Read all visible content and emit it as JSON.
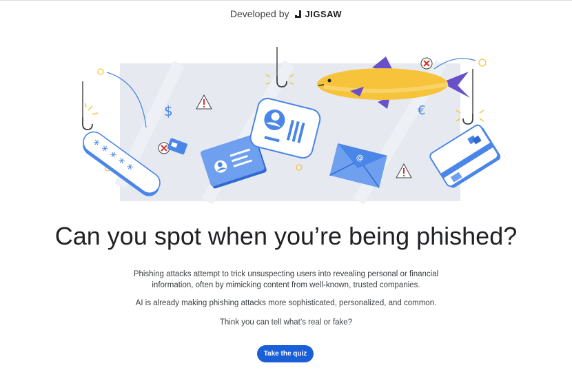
{
  "header": {
    "developed_by": "Developed by",
    "brand": "JIGSAW"
  },
  "hero": {
    "illustration_icons": [
      "fishing-hook-icon",
      "password-card-icon",
      "credit-card-icon",
      "id-card-icon",
      "profile-card-icon",
      "fish-icon",
      "email-envelope-icon",
      "warning-icon",
      "dollar-icon",
      "euro-icon",
      "error-x-icon"
    ]
  },
  "main": {
    "headline": "Can you spot when you’re being phished?",
    "paragraph1_line1": "Phishing attacks attempt to trick unsuspecting users into revealing personal or financial",
    "paragraph1_line2": "information, often by mimicking content from well-known, trusted companies.",
    "paragraph2": "AI is already making phishing attacks more sophisticated, personalized, and common.",
    "paragraph3": "Think you can tell what’s real or fake?",
    "cta_label": "Take the quiz"
  },
  "colors": {
    "accent": "#1a5fd8",
    "illustration_blue": "#4a86e8",
    "fish_yellow": "#f6c33b",
    "fin_purple": "#6750c8",
    "warning_red": "#d93025",
    "backdrop": "#e6e9f0"
  }
}
